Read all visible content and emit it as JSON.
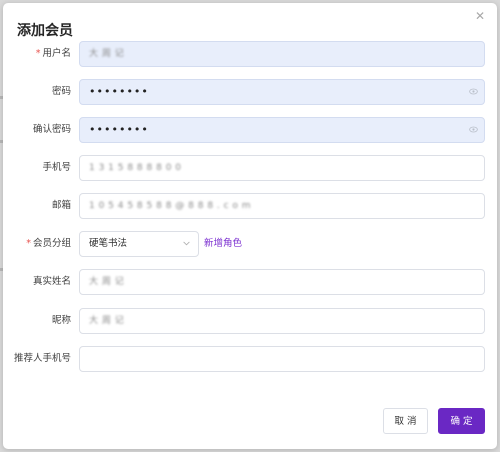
{
  "dialog": {
    "title": "添加会员",
    "close_icon": "close-icon"
  },
  "form": {
    "username": {
      "label": "用户名",
      "required": "*",
      "value": "大 周 记"
    },
    "password": {
      "label": "密码",
      "value": "••••••••",
      "icon": "eye-icon"
    },
    "confirm_password": {
      "label": "确认密码",
      "value": "••••••••",
      "icon": "eye-icon"
    },
    "phone": {
      "label": "手机号",
      "value": "1 3 1 5 8 8 8 8 0 0"
    },
    "email": {
      "label": "邮箱",
      "value": "1 0 5 4 5 8 5 8 8 @ 8 8 8 . c o m"
    },
    "member_group": {
      "label": "会员分组",
      "required": "*",
      "value": "硬笔书法",
      "icon": "chevron-down-icon"
    },
    "add_role_link": "新增角色",
    "real_name": {
      "label": "真实姓名",
      "value": "大 周 记"
    },
    "nickname": {
      "label": "昵称",
      "value": "大 周 记"
    },
    "referrer_phone": {
      "label": "推荐人手机号",
      "value": ""
    }
  },
  "footer": {
    "cancel_label": "取 消",
    "confirm_label": "确 定"
  },
  "colors": {
    "accent": "#6a28c4",
    "link": "#7b2fd0",
    "required": "#e8534f",
    "filled_input_bg": "#e8eefb"
  }
}
